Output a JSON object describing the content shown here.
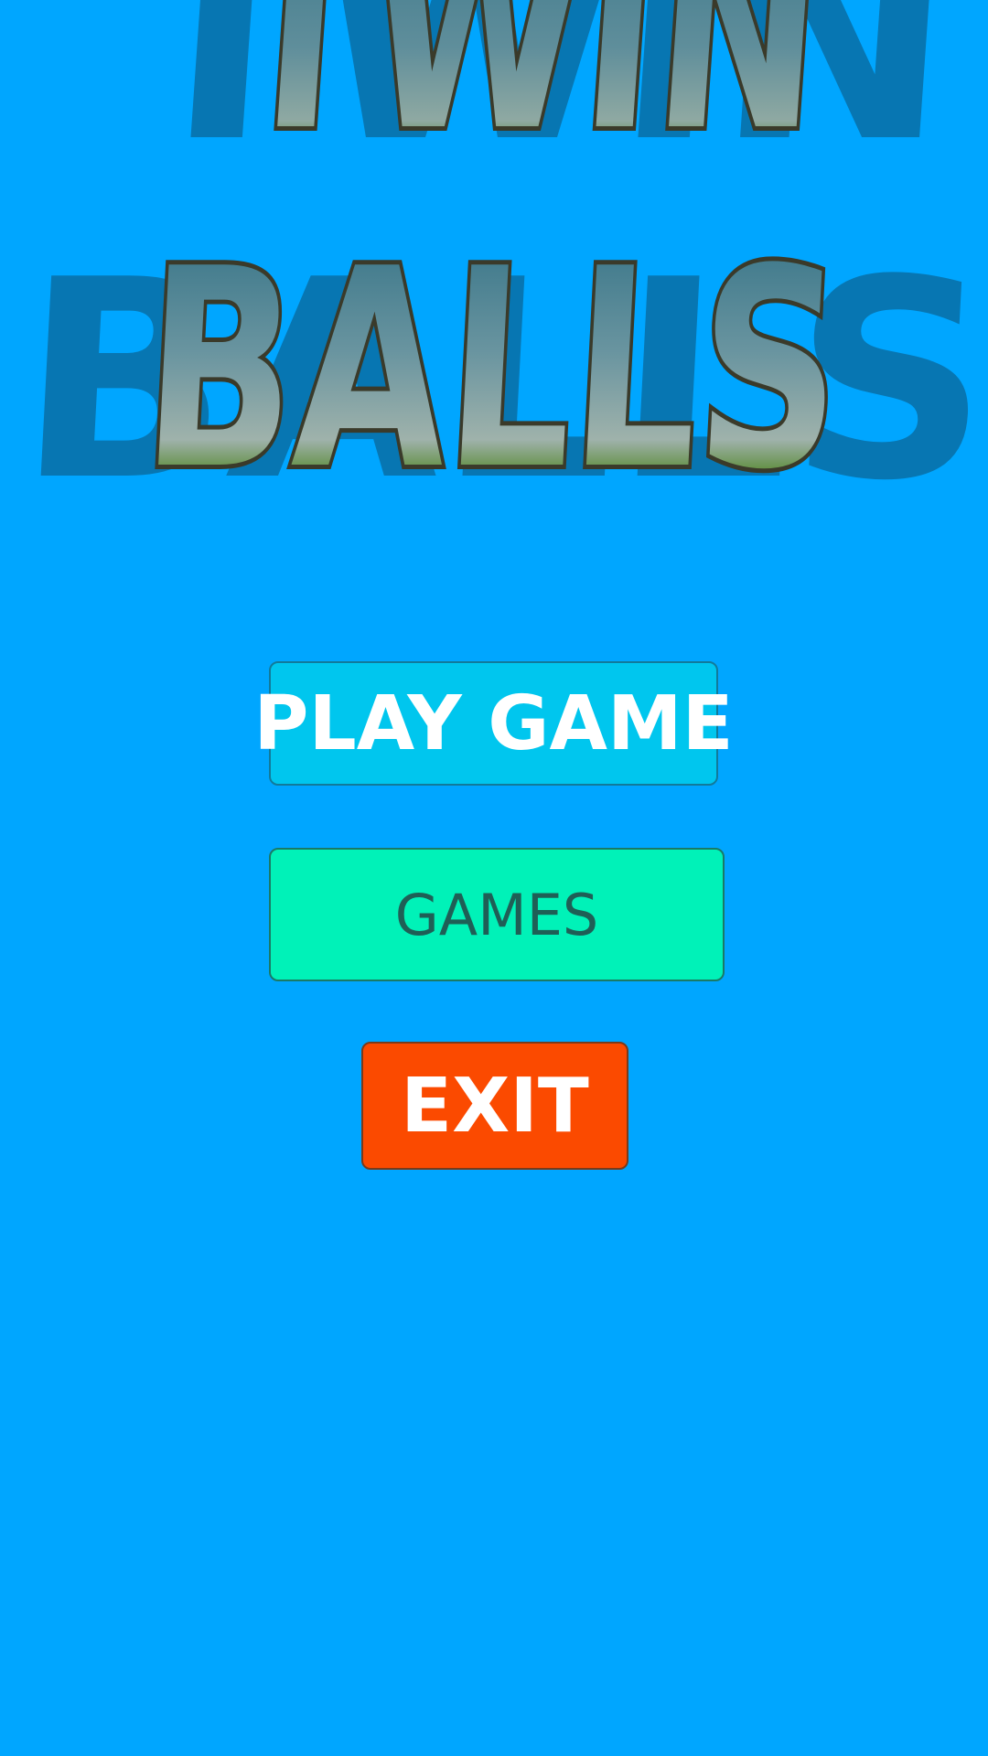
{
  "game": {
    "title_line1": "TWIN",
    "title_line2": "BALLS"
  },
  "menu": {
    "play_label": "PLAY GAME",
    "games_label": "GAMES",
    "exit_label": "EXIT"
  },
  "colors": {
    "background": "#00a6ff",
    "play_button": "#00c6ee",
    "games_button": "#00f2b8",
    "exit_button": "#fb4a00"
  }
}
